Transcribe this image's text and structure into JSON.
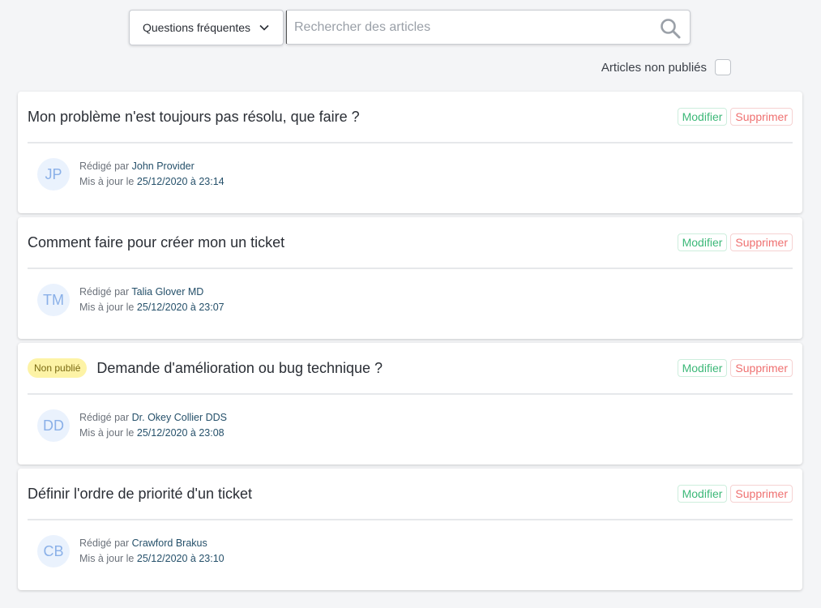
{
  "search": {
    "category_label": "Questions fréquentes",
    "placeholder": "Rechercher des articles"
  },
  "filter": {
    "unpublished_label": "Articles non publiés",
    "unpublished_checked": false
  },
  "labels": {
    "edit": "Modifier",
    "delete": "Supprimer",
    "written_by": "Rédigé par",
    "updated_on": "Mis à jour le",
    "unpublished_badge": "Non publié"
  },
  "articles": [
    {
      "title": "Mon problème n'est toujours pas résolu, que faire ?",
      "unpublished": false,
      "initials": "JP",
      "author": "John Provider",
      "updated": "25/12/2020 à 23:14"
    },
    {
      "title": "Comment faire pour créer mon un ticket",
      "unpublished": false,
      "initials": "TM",
      "author": "Talia Glover MD",
      "updated": "25/12/2020 à 23:07"
    },
    {
      "title": "Demande d'amélioration ou bug technique ?",
      "unpublished": true,
      "initials": "DD",
      "author": "Dr. Okey Collier DDS",
      "updated": "25/12/2020 à 23:08"
    },
    {
      "title": "Définir l'ordre de priorité d'un ticket",
      "unpublished": false,
      "initials": "CB",
      "author": "Crawford Brakus",
      "updated": "25/12/2020 à 23:10"
    }
  ],
  "colors": {
    "edit": "#3cb878",
    "delete": "#ef7070",
    "badge_bg": "#fdf3a6",
    "avatar_text": "#8ab0e8"
  }
}
